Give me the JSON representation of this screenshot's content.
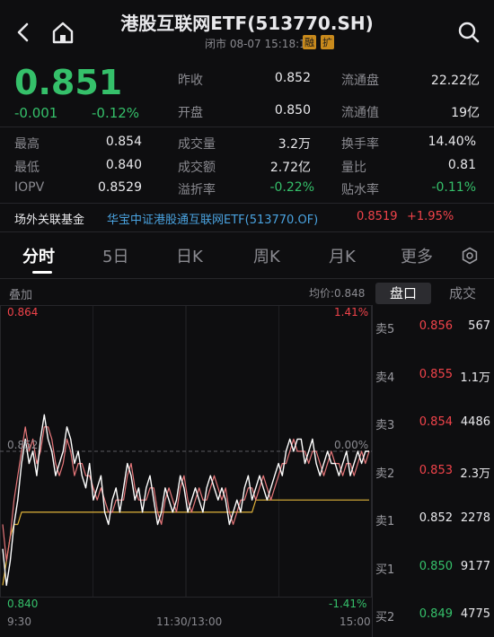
{
  "header": {
    "title": "港股互联网ETF(513770.SH)",
    "status": "闭市 08-07 15:18:15",
    "badge1": "融",
    "badge2": "扩"
  },
  "quote": {
    "price": "0.851",
    "change": "-0.001",
    "change_pct": "-0.12%"
  },
  "stats": {
    "prev_close_label": "昨收",
    "prev_close": "0.852",
    "float_shares_label": "流通盘",
    "float_shares": "22.22亿",
    "open_label": "开盘",
    "open": "0.850",
    "float_value_label": "流通值",
    "float_value": "19亿",
    "high_label": "最高",
    "high": "0.854",
    "volume_label": "成交量",
    "volume": "3.2万",
    "turnover_label": "换手率",
    "turnover": "14.40%",
    "low_label": "最低",
    "low": "0.840",
    "amount_label": "成交额",
    "amount": "2.72亿",
    "vol_ratio_label": "量比",
    "vol_ratio": "0.81",
    "iopv_label": "IOPV",
    "iopv": "0.8529",
    "premium_label": "溢折率",
    "premium": "-0.22%",
    "discount_label": "贴水率",
    "discount": "-0.11%"
  },
  "fund": {
    "label": "场外关联基金",
    "name": "华宝中证港股通互联网ETF(513770.OF)",
    "nav": "0.8519",
    "nav_change": "+1.95%"
  },
  "tabs": [
    "分时",
    "5日",
    "日K",
    "周K",
    "月K",
    "更多"
  ],
  "chart_header": {
    "overlay_label": "叠加",
    "avg_price": "均价:0.848",
    "tab_orderbook": "盘口",
    "tab_trades": "成交"
  },
  "chart_labels": {
    "top_price": "0.864",
    "top_pct": "1.41%",
    "mid_price": "0.852",
    "mid_pct": "0.00%",
    "bottom_price": "0.840",
    "bottom_pct": "-1.41%",
    "time_start": "9:30",
    "time_mid": "11:30/13:00",
    "time_end": "15:00"
  },
  "orderbook": [
    {
      "label": "卖5",
      "price": "0.856",
      "vol": "567",
      "color": "red"
    },
    {
      "label": "卖4",
      "price": "0.855",
      "vol": "1.1万",
      "color": "red"
    },
    {
      "label": "卖3",
      "price": "0.854",
      "vol": "4486",
      "color": "red"
    },
    {
      "label": "卖2",
      "price": "0.853",
      "vol": "2.3万",
      "color": "red"
    },
    {
      "label": "卖1",
      "price": "0.852",
      "vol": "2278",
      "color": "white"
    },
    {
      "label": "买1",
      "price": "0.850",
      "vol": "9177",
      "color": "green"
    },
    {
      "label": "买2",
      "price": "0.849",
      "vol": "4775",
      "color": "green"
    }
  ],
  "chart_data": {
    "type": "line",
    "ylim": [
      0.84,
      0.864
    ],
    "prev_close": 0.852,
    "series": [
      {
        "name": "price",
        "color": "#ffffff",
        "values": [
          0.844,
          0.841,
          0.843,
          0.846,
          0.848,
          0.851,
          0.853,
          0.851,
          0.852,
          0.85,
          0.853,
          0.855,
          0.853,
          0.852,
          0.85,
          0.851,
          0.852,
          0.854,
          0.853,
          0.851,
          0.852,
          0.85,
          0.849,
          0.851,
          0.848,
          0.849,
          0.85,
          0.847,
          0.846,
          0.848,
          0.849,
          0.847,
          0.849,
          0.851,
          0.85,
          0.848,
          0.849,
          0.847,
          0.849,
          0.85,
          0.848,
          0.846,
          0.847,
          0.849,
          0.848,
          0.847,
          0.848,
          0.85,
          0.849,
          0.847,
          0.848,
          0.849,
          0.848,
          0.847,
          0.849,
          0.85,
          0.849,
          0.848,
          0.849,
          0.848,
          0.846,
          0.847,
          0.848,
          0.847,
          0.849,
          0.85,
          0.848,
          0.849,
          0.85,
          0.849,
          0.848,
          0.849,
          0.85,
          0.851,
          0.85,
          0.852,
          0.853,
          0.852,
          0.853,
          0.853,
          0.851,
          0.852,
          0.853,
          0.851,
          0.85,
          0.851,
          0.852,
          0.851,
          0.851,
          0.85,
          0.851,
          0.852,
          0.85,
          0.851,
          0.852,
          0.851,
          0.852,
          0.852
        ]
      },
      {
        "name": "nav",
        "color": "#e7777a",
        "values": [
          0.846,
          0.843,
          0.845,
          0.848,
          0.85,
          0.852,
          0.854,
          0.852,
          0.853,
          0.851,
          0.852,
          0.854,
          0.854,
          0.853,
          0.851,
          0.85,
          0.851,
          0.853,
          0.852,
          0.85,
          0.851,
          0.851,
          0.85,
          0.85,
          0.849,
          0.848,
          0.849,
          0.848,
          0.847,
          0.847,
          0.848,
          0.848,
          0.848,
          0.85,
          0.851,
          0.849,
          0.848,
          0.848,
          0.848,
          0.849,
          0.849,
          0.847,
          0.846,
          0.848,
          0.849,
          0.848,
          0.847,
          0.849,
          0.85,
          0.848,
          0.847,
          0.848,
          0.849,
          0.848,
          0.848,
          0.849,
          0.85,
          0.849,
          0.848,
          0.849,
          0.847,
          0.846,
          0.847,
          0.848,
          0.848,
          0.849,
          0.849,
          0.848,
          0.849,
          0.85,
          0.849,
          0.848,
          0.849,
          0.85,
          0.851,
          0.851,
          0.852,
          0.853,
          0.852,
          0.852,
          0.852,
          0.851,
          0.852,
          0.852,
          0.851,
          0.85,
          0.851,
          0.852,
          0.851,
          0.851,
          0.85,
          0.851,
          0.851,
          0.85,
          0.851,
          0.852,
          0.851,
          0.852
        ]
      },
      {
        "name": "avg",
        "color": "#e0b33a",
        "values": [
          0.841,
          0.843,
          0.845,
          0.846,
          0.846,
          0.847,
          0.847,
          0.847,
          0.847,
          0.847,
          0.847,
          0.847,
          0.847,
          0.847,
          0.847,
          0.847,
          0.847,
          0.847,
          0.847,
          0.847,
          0.847,
          0.847,
          0.847,
          0.847,
          0.847,
          0.847,
          0.847,
          0.847,
          0.847,
          0.847,
          0.847,
          0.847,
          0.847,
          0.847,
          0.847,
          0.847,
          0.847,
          0.847,
          0.847,
          0.847,
          0.847,
          0.847,
          0.847,
          0.847,
          0.847,
          0.847,
          0.847,
          0.847,
          0.847,
          0.847,
          0.847,
          0.847,
          0.847,
          0.847,
          0.847,
          0.847,
          0.847,
          0.847,
          0.847,
          0.847,
          0.847,
          0.847,
          0.847,
          0.847,
          0.847,
          0.847,
          0.847,
          0.848,
          0.848,
          0.848,
          0.848,
          0.848,
          0.848,
          0.848,
          0.848,
          0.848,
          0.848,
          0.848,
          0.848,
          0.848,
          0.848,
          0.848,
          0.848,
          0.848,
          0.848,
          0.848,
          0.848,
          0.848,
          0.848,
          0.848,
          0.848,
          0.848,
          0.848,
          0.848,
          0.848,
          0.848,
          0.848,
          0.848
        ]
      }
    ]
  }
}
